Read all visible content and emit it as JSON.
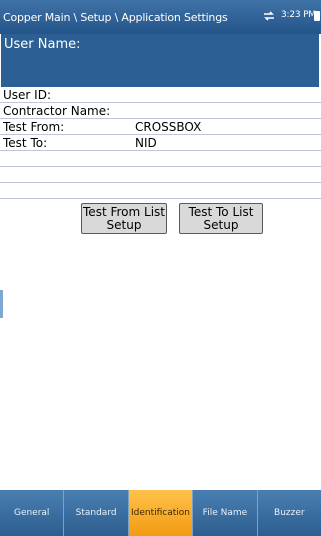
{
  "titlebar": {
    "title": "Copper Main \\ Setup \\ Application Settings",
    "time": "3:23 PM",
    "usb_icon": "usb-icon",
    "battery_icon": "battery-icon"
  },
  "user_name_label": "User Name:",
  "fields": {
    "user_id_label": "User ID:",
    "contractor_label": "Contractor Name:",
    "test_from_label": "Test From:",
    "test_from_value": "CROSSBOX",
    "test_to_label": "Test To:",
    "test_to_value": "NID"
  },
  "buttons": {
    "test_from_list_line1": "Test From List",
    "test_from_list_line2": "Setup",
    "test_to_list_line1": "Test To List",
    "test_to_list_line2": "Setup"
  },
  "tabs": [
    {
      "label": "General"
    },
    {
      "label": "Standard"
    },
    {
      "label": "Identification",
      "active": true
    },
    {
      "label": "File Name"
    },
    {
      "label": "Buzzer"
    }
  ],
  "colors": {
    "header_blue": "#2c5f94",
    "active_tab": "#f29a12"
  }
}
